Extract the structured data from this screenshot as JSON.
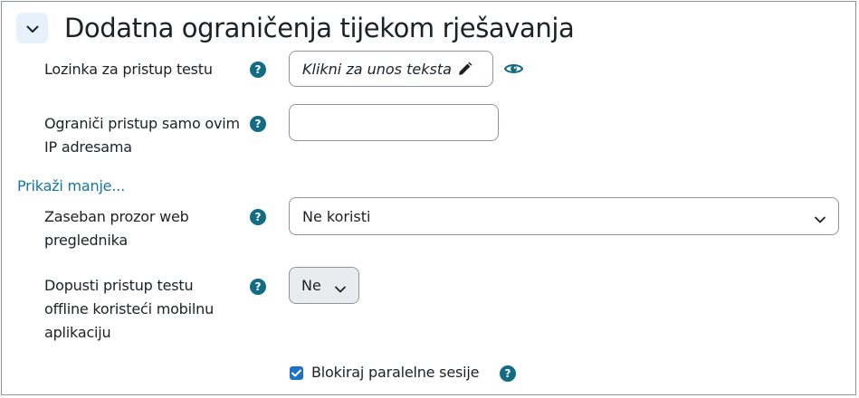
{
  "section": {
    "title": "Dodatna ograničenja tijekom rješavanja",
    "collapse_icon": "chevron-down-icon"
  },
  "fields": {
    "password": {
      "label": "Lozinka za pristup testu",
      "value": "Klikni za unos teksta",
      "help": "?",
      "edit_icon": "pencil-icon",
      "reveal_icon": "eye-icon"
    },
    "ip_restrict": {
      "label_line1": "Ograniči pristup samo ovim",
      "label_line2": "IP adresama",
      "help": "?",
      "value": ""
    },
    "show_less": "Prikaži manje...",
    "browser_window": {
      "label_line1": "Zaseban prozor web",
      "label_line2": "preglednika",
      "help": "?",
      "selected": "Ne koristi"
    },
    "offline_attempts": {
      "label_line1": "Dopusti pristup testu",
      "label_line2": "offline koristeći mobilnu",
      "label_line3": "aplikaciju",
      "help": "?",
      "selected": "Ne"
    },
    "block_concurrent": {
      "label": "Blokiraj paralelne sesije",
      "checked": true,
      "help": "?"
    }
  },
  "colors": {
    "link": "#1578a0",
    "help_badge": "#146c84",
    "checkbox": "#1a73c4",
    "collapse_bg": "#e7f1fb"
  }
}
